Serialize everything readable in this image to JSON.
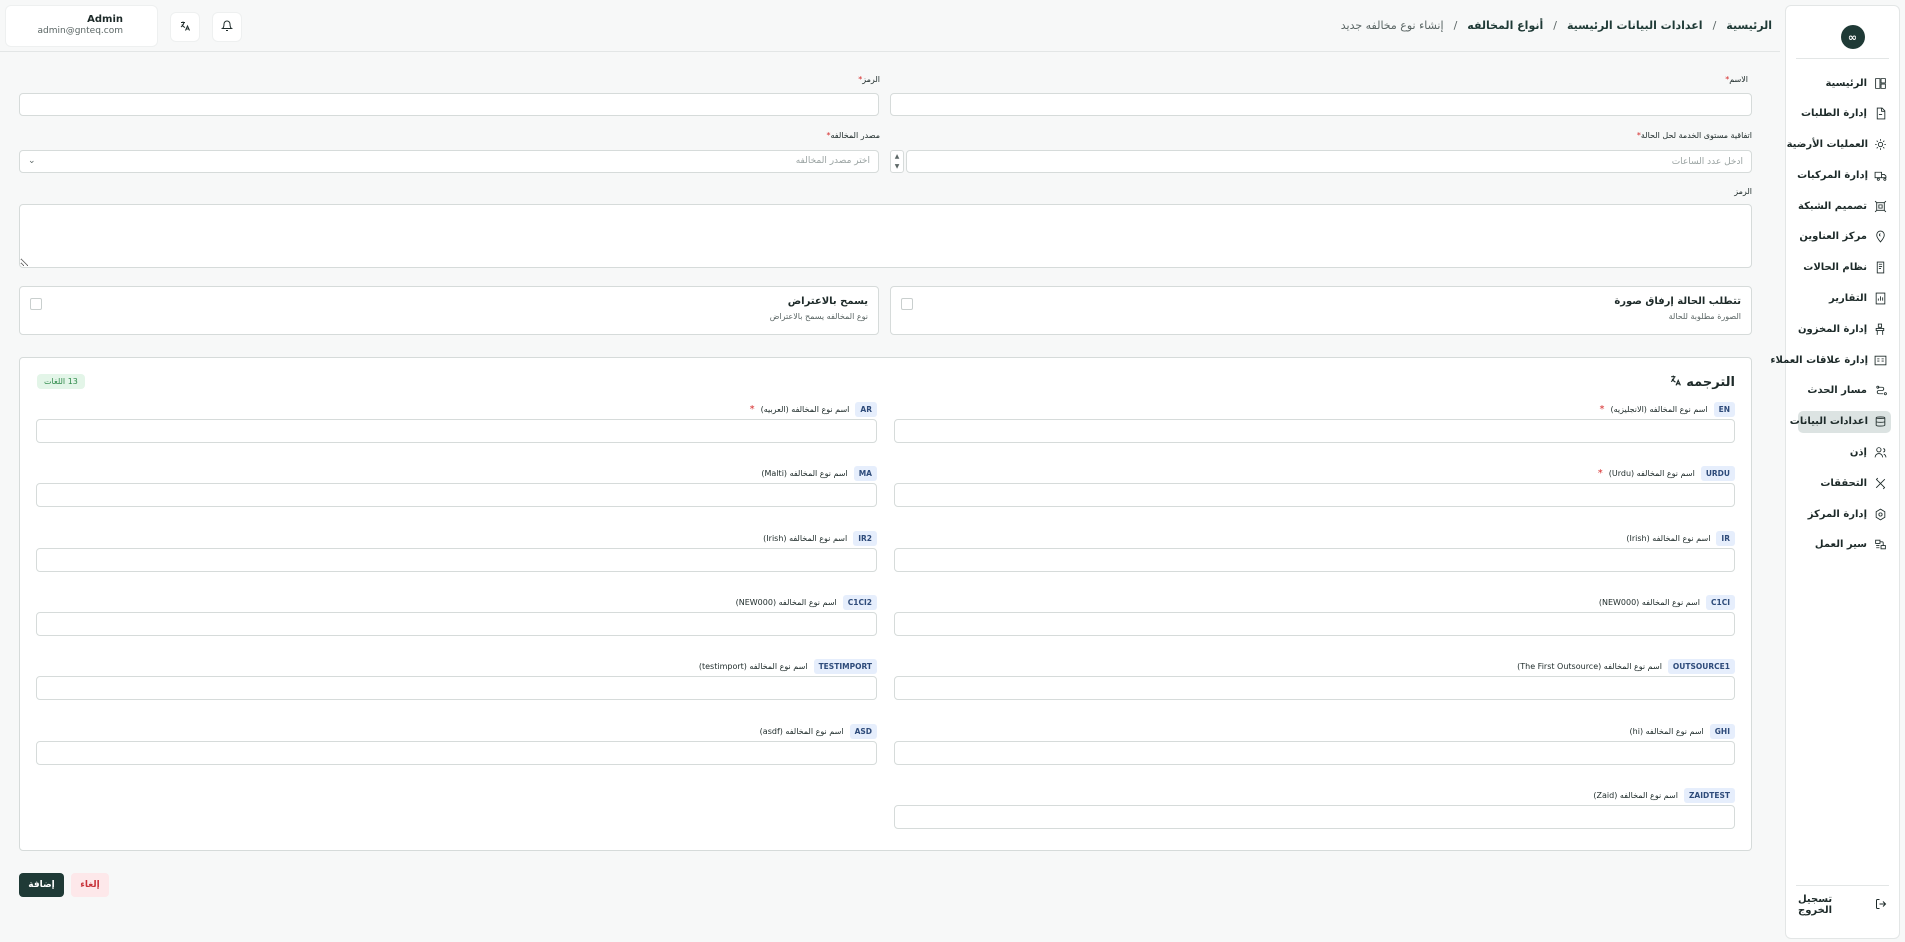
{
  "header": {
    "user_name": "Admin",
    "user_email": "admin@gnteq.com",
    "breadcrumb": [
      "الرئيسية",
      "اعدادات البيانات الرئيسية",
      "أنواع المخالفه",
      "إنشاء نوع مخالفه جديد"
    ]
  },
  "sidebar": {
    "logo_text": "∞",
    "items": [
      {
        "label": "الرئيسية",
        "icon": "home-icon"
      },
      {
        "label": "إدارة الطلبات",
        "icon": "orders-icon"
      },
      {
        "label": "العمليات الأرضية",
        "icon": "operations-icon"
      },
      {
        "label": "إدارة المركبات",
        "icon": "truck-icon"
      },
      {
        "label": "تصميم الشبكة",
        "icon": "network-icon"
      },
      {
        "label": "مركز العناوين",
        "icon": "address-icon"
      },
      {
        "label": "نظام الحالات",
        "icon": "status-icon"
      },
      {
        "label": "التقارير",
        "icon": "reports-icon"
      },
      {
        "label": "إدارة المخزون",
        "icon": "inventory-icon"
      },
      {
        "label": "إدارة علاقات العملاء",
        "icon": "crm-icon"
      },
      {
        "label": "مسار الحدث",
        "icon": "route-icon"
      },
      {
        "label": "اعدادات البيانات",
        "icon": "database-icon",
        "active": true
      },
      {
        "label": "إذن",
        "icon": "permission-icon"
      },
      {
        "label": "التحققات",
        "icon": "validation-icon"
      },
      {
        "label": "إدارة المركز",
        "icon": "center-icon"
      },
      {
        "label": "سير العمل",
        "icon": "workflow-icon"
      }
    ],
    "logout_label": "تسجيل الخروج"
  },
  "form": {
    "name_label": "الاسم",
    "code_label": "الرمز",
    "sla_label": "اتفاقية مستوى الخدمة لحل الحالة",
    "sla_placeholder": "أدخل عدد الساعات",
    "source_label": "مصدر المخالفه",
    "source_placeholder": "اختر مصدر المخالفه",
    "description_label": "الرمز",
    "photo_title": "تتطلب الحالة إرفاق صورة",
    "photo_sub": "الصورة مطلوبة للحالة",
    "objection_title": "يسمح بالاعتراض",
    "objection_sub": "نوع المخالفه يسمح بالاعتراض"
  },
  "translations": {
    "title": "الترجمه",
    "badge": "13 اللغات",
    "fields": [
      {
        "code": "EN",
        "label": "اسم نوع المخالفه (الانجليزيه)",
        "required": true
      },
      {
        "code": "AR",
        "label": "اسم نوع المخالفه (العربيه)",
        "required": true
      },
      {
        "code": "URDU",
        "label": "اسم نوع المخالفه (Urdu)",
        "required": true
      },
      {
        "code": "MA",
        "label": "اسم نوع المخالفه (Malti)",
        "required": false
      },
      {
        "code": "IR",
        "label": "اسم نوع المخالفه (Irish)",
        "required": false
      },
      {
        "code": "IR2",
        "label": "اسم نوع المخالفه (Irish)",
        "required": false
      },
      {
        "code": "C1CI",
        "label": "اسم نوع المخالفه (NEW000)",
        "required": false
      },
      {
        "code": "C1CI2",
        "label": "اسم نوع المخالفه (NEW000)",
        "required": false
      },
      {
        "code": "OUTSOURCE1",
        "label": "اسم نوع المخالفه (The First Outsource)",
        "required": false
      },
      {
        "code": "TESTIMPORT",
        "label": "اسم نوع المخالفه (testimport)",
        "required": false
      },
      {
        "code": "GHI",
        "label": "اسم نوع المخالفه (hi)",
        "required": false
      },
      {
        "code": "ASD",
        "label": "اسم نوع المخالفه (asdf)",
        "required": false
      },
      {
        "code": "ZAIDTEST",
        "label": "اسم نوع المخالفه (Zaid)",
        "required": false
      }
    ]
  },
  "actions": {
    "add_label": "إضافة",
    "cancel_label": "إلغاء"
  },
  "colors": {
    "primary": "#1f3a36",
    "required": "#d62b2b",
    "badge_bg": "#e3f5e8",
    "badge_text": "#2f8a4a"
  }
}
